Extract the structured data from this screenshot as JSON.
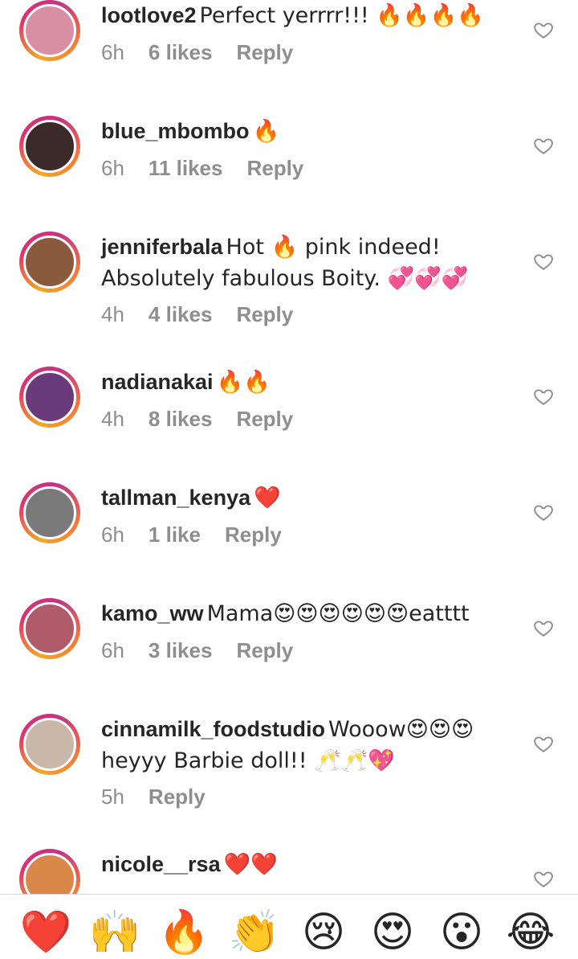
{
  "comments": [
    {
      "username": "lootlove2",
      "text": "Perfect yerrrr!!! 🔥🔥🔥🔥",
      "time": "6h",
      "likes": "6 likes",
      "reply": "Reply",
      "avatar_color": "#d88fa4"
    },
    {
      "username": "blue_mbombo",
      "text": "🔥",
      "time": "6h",
      "likes": "11 likes",
      "reply": "Reply",
      "avatar_color": "#3a2a28"
    },
    {
      "username": "jenniferbala",
      "text": "Hot 🔥 pink indeed! Absolutely fabulous Boity. 💞💞💞",
      "time": "4h",
      "likes": "4 likes",
      "reply": "Reply",
      "avatar_color": "#8a5a3c"
    },
    {
      "username": "nadianakai",
      "text": "🔥🔥",
      "time": "4h",
      "likes": "8 likes",
      "reply": "Reply",
      "avatar_color": "#6a3b7a"
    },
    {
      "username": "tallman_kenya",
      "text": "❤️",
      "time": "6h",
      "likes": "1 like",
      "reply": "Reply",
      "avatar_color": "#7a7a7a"
    },
    {
      "username": "kamo_ww",
      "text": "Mama😍😍😍😍😍😍eatttt",
      "time": "6h",
      "likes": "3 likes",
      "reply": "Reply",
      "avatar_color": "#b05a6a"
    },
    {
      "username": "cinnamilk_foodstudio",
      "text": "Wooow😍😍😍 heyyy Barbie doll!! 🥂🥂💖",
      "time": "5h",
      "likes": "",
      "reply": "Reply",
      "avatar_color": "#c9b8a8"
    },
    {
      "username": "nicole__rsa",
      "text": "❤️❤️",
      "time": "",
      "likes": "",
      "reply": "",
      "avatar_color": "#d9884a"
    }
  ],
  "reactions": [
    "❤️",
    "🙌",
    "🔥",
    "👏",
    "😢",
    "😍",
    "😮",
    "😂"
  ],
  "colors": {
    "accent_ring": "#e1306c",
    "meta": "#8e8e8e",
    "text": "#262626"
  }
}
